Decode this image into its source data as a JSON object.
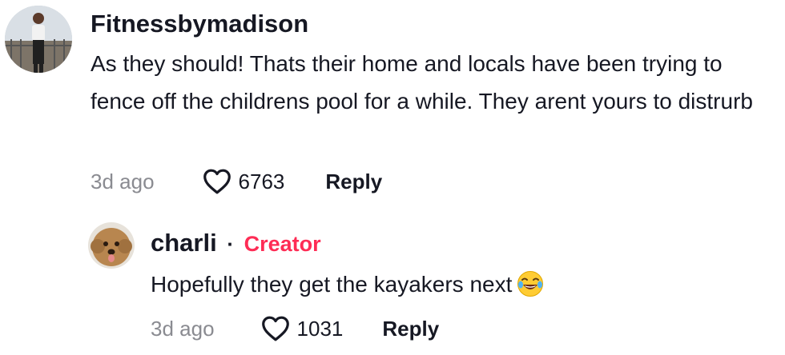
{
  "comments": [
    {
      "username": "Fitnessbymadison",
      "text": "As they should! Thats their home and locals have been trying to fence off the childrens pool for a while. They arent yours to distrurb",
      "time": "3d ago",
      "likes": "6763",
      "reply_label": "Reply",
      "avatar_icon": "user-avatar-photo"
    },
    {
      "username": "charli",
      "separator": "·",
      "badge": "Creator",
      "text": "Hopefully they get the kayakers next",
      "emoji": "face-with-tears-of-joy",
      "time": "3d ago",
      "likes": "1031",
      "reply_label": "Reply",
      "avatar_icon": "dog-avatar-photo"
    }
  ],
  "colors": {
    "text": "#161823",
    "muted": "#8a8b91",
    "creator": "#fe2c55"
  }
}
